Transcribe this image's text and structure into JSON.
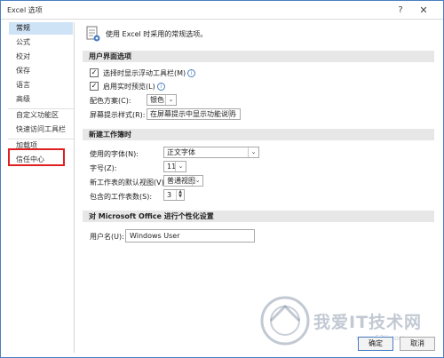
{
  "window": {
    "title": "Excel 选项",
    "help_glyph": "?",
    "close_glyph": "✕"
  },
  "sidebar": {
    "items": [
      {
        "label": "常规"
      },
      {
        "label": "公式"
      },
      {
        "label": "校对"
      },
      {
        "label": "保存"
      },
      {
        "label": "语言"
      },
      {
        "label": "高级"
      },
      {
        "label": "自定义功能区"
      },
      {
        "label": "快速访问工具栏"
      },
      {
        "label": "加载项"
      },
      {
        "label": "信任中心"
      }
    ],
    "selected_index": 0
  },
  "content": {
    "header": "使用 Excel 时采用的常规选项。",
    "ui_section": {
      "title": "用户界面选项",
      "show_mini_toolbar": "选择时显示浮动工具栏(M)",
      "live_preview": "启用实时预览(L)",
      "color_scheme_label": "配色方案(C):",
      "color_scheme_value": "银色",
      "screentip_label": "屏幕提示样式(R):",
      "screentip_value": "在屏幕提示中显示功能说明"
    },
    "new_workbook_section": {
      "title": "新建工作簿时",
      "font_label": "使用的字体(N):",
      "font_value": "正文字体",
      "size_label": "字号(Z):",
      "size_value": "11",
      "view_label": "新工作表的默认视图(V):",
      "view_value": "普通视图",
      "sheets_label": "包含的工作表数(S):",
      "sheets_value": "3"
    },
    "personalize_section": {
      "title": "对 Microsoft Office 进行个性化设置",
      "username_label": "用户名(U):",
      "username_value": "Windows User"
    }
  },
  "buttons": {
    "ok": "确定",
    "cancel": "取消"
  },
  "watermark": {
    "text": "我爱IT技术网",
    "sub": "www.52ij.com"
  },
  "colors": {
    "accent": "#4a7fc1",
    "selected_bg": "#cfe3f7",
    "highlight": "#e02020"
  }
}
